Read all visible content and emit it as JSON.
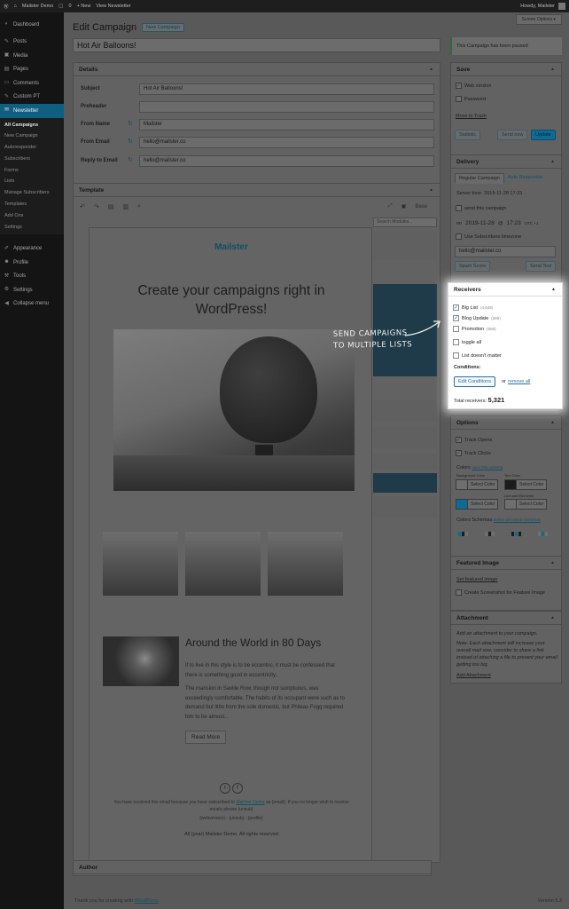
{
  "adminbar": {
    "site_name": "Mailster Demo",
    "comments_count": "0",
    "new_label": "+ New",
    "view_label": "View Newsletter",
    "howdy": "Howdy, Mailster"
  },
  "sidebar": {
    "items_top": [
      {
        "label": "Dashboard",
        "icon": "dashboard-icon"
      },
      {
        "label": "Posts",
        "icon": "pin-icon"
      },
      {
        "label": "Media",
        "icon": "media-icon"
      },
      {
        "label": "Pages",
        "icon": "pages-icon"
      },
      {
        "label": "Comments",
        "icon": "comments-icon"
      },
      {
        "label": "Custom PT",
        "icon": "pin-icon"
      },
      {
        "label": "Newsletter",
        "icon": "mail-icon"
      }
    ],
    "sub_items": [
      "All Campaigns",
      "New Campaign",
      "Autoresponder",
      "Subscribers",
      "Forms",
      "Lists",
      "Manage Subscribers",
      "Templates",
      "Add Ons",
      "Settings"
    ],
    "items_bottom": [
      {
        "label": "Appearance",
        "icon": "brush-icon"
      },
      {
        "label": "Profile",
        "icon": "user-icon"
      },
      {
        "label": "Tools",
        "icon": "wrench-icon"
      },
      {
        "label": "Settings",
        "icon": "settings-icon"
      },
      {
        "label": "Collapse menu",
        "icon": "collapse-icon"
      }
    ]
  },
  "screen_options": "Screen Options ▾",
  "page": {
    "title": "Edit Campaign",
    "new_button": "New Campaign",
    "campaign_title": "Hot Air Balloons!"
  },
  "details": {
    "heading": "Details",
    "subject_label": "Subject",
    "subject_value": "Hot Air Balloons!",
    "preheader_label": "Preheader",
    "preheader_value": "",
    "from_name_label": "From Name",
    "from_name_value": "Mailster",
    "from_email_label": "From Email",
    "from_email_value": "hello@mailster.co",
    "reply_label": "Reply-to Email",
    "reply_value": "hello@mailster.co"
  },
  "template": {
    "heading": "Template",
    "base_label": "Base",
    "module_search_placeholder": "Search Modules...",
    "logo": "Mailster",
    "headline_1": "Create your campaigns right in",
    "headline_2": "WordPress!",
    "article_title": "Around the World in 80 Days",
    "article_p1": "If to live in this style is to be eccentric, it must be confessed that there is something good in eccentricity.",
    "article_p2": "The mansion in Saville Row, though not sumptuous, was exceedingly comfortable. The habits of its occupant were such as to demand but little from the sole domestic, but Phileas Fogg required him to be almost...",
    "read_more": "Read More",
    "footer_1": "You have received this email because you have subscribed to",
    "footer_link": "Mailster Demo",
    "footer_2": "as {email}. If you no longer wish to receive emails please {unsub}",
    "footer_3": "{webversion} - {unsub} - {profile}",
    "copyright": "All {year} Mailster Demo. All rights reserved"
  },
  "author_heading": "Author",
  "footer": {
    "thanks": "Thank you for creating with",
    "wp": "WordPress",
    "version": "Version 5.3"
  },
  "notice": "This Campaign has been paused",
  "save": {
    "heading": "Save",
    "web_version": "Web version",
    "password": "Password",
    "trash": "Move to Trash",
    "statistic": "Statistic",
    "send_now": "Send now",
    "update": "Update"
  },
  "delivery": {
    "heading": "Delivery",
    "tab_regular": "Regular Campaign",
    "tab_auto": "Auto Responder",
    "server_time": "Server time: 2019-11-28 17:23",
    "send_this": "send this campaign",
    "on": "on",
    "date": "2019-11-28",
    "at": "@",
    "time": "17:23",
    "tz": "UTC +1",
    "use_tz": "Use Subscribers timezone",
    "email": "hello@mailster.co",
    "spam": "Spam Score",
    "send_test": "Send Test"
  },
  "receivers": {
    "heading": "Receivers",
    "lists": [
      {
        "name": "Big List",
        "count": "(4,649)",
        "checked": true
      },
      {
        "name": "Blog Update",
        "count": "(385)",
        "checked": true
      },
      {
        "name": "Promotion",
        "count": "(669)",
        "checked": false
      }
    ],
    "toggle_all": "toggle all",
    "doesnt_matter": "List doesn't matter",
    "conditions": "Conditions:",
    "edit_conditions": "Edit Conditions",
    "or": "or",
    "remove_all": "remove all",
    "total_label": "Total receivers:",
    "total_value": "5,321"
  },
  "annotation": {
    "line1": "SEND CAMPAIGNS",
    "line2": "TO MULTIPLE LISTS"
  },
  "options": {
    "heading": "Options",
    "track_opens": "Track Opens",
    "track_clicks": "Track Clicks",
    "colors_label": "Colors",
    "save_scheme": "save this schema",
    "bg_color": "Background Color",
    "text_color": "Text Color",
    "select_color": "Select Color",
    "line_label": "Line and Elements",
    "schemas_label": "Colors Schemas",
    "delete_schemas": "delete all custom schemas"
  },
  "featured": {
    "heading": "Featured Image",
    "set": "Set featured image",
    "screenshot": "Create Screenshot for Feature Image"
  },
  "attachment": {
    "heading": "Attachment",
    "desc": "Add an attachment to your campaign.",
    "note": "Note: Each attachment will increase your overall mail size, consider to share a link instead of attaching a file to prevent your email getting too big.",
    "add": "Add Attachment"
  },
  "colors": {
    "accent": "#0b6d96",
    "highlight": "#ffffff",
    "paused": "#2e6a35"
  }
}
